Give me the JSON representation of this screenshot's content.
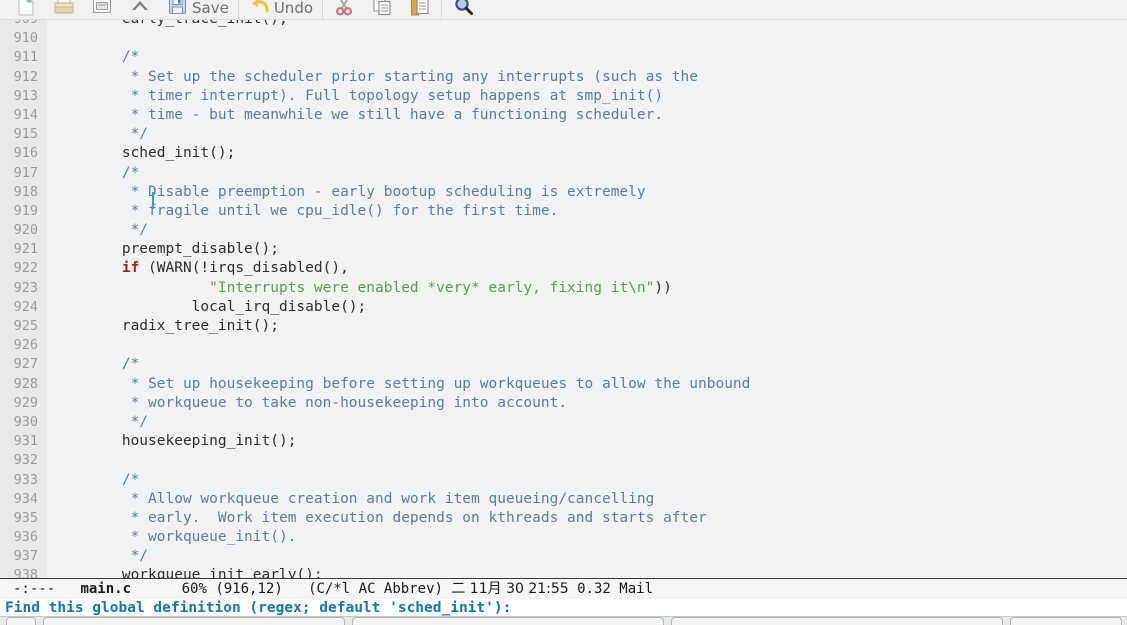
{
  "toolbar": {
    "items": [
      {
        "name": "new-file-icon",
        "icon": "new-file",
        "label": ""
      },
      {
        "name": "open-file-icon",
        "icon": "open-file",
        "label": ""
      },
      {
        "name": "dired-icon",
        "icon": "dired",
        "label": ""
      },
      {
        "name": "close-buffer-icon",
        "icon": "close-buffer",
        "label": ""
      },
      {
        "name": "save-button",
        "icon": "save",
        "label": "Save"
      },
      {
        "name": "undo-button",
        "icon": "undo",
        "label": "Undo"
      },
      {
        "name": "cut-icon",
        "icon": "cut",
        "label": ""
      },
      {
        "name": "copy-icon",
        "icon": "copy",
        "label": ""
      },
      {
        "name": "paste-icon",
        "icon": "paste",
        "label": ""
      },
      {
        "name": "search-icon",
        "icon": "search",
        "label": ""
      }
    ]
  },
  "buffer": {
    "first_line": 909,
    "lines": [
      {
        "num": "909",
        "segments": [
          {
            "text": "        early_trace_init();",
            "style": "plain"
          }
        ]
      },
      {
        "num": "910",
        "segments": [
          {
            "text": "",
            "style": "plain"
          }
        ]
      },
      {
        "num": "911",
        "segments": [
          {
            "text": "        /*",
            "style": "cmt"
          }
        ]
      },
      {
        "num": "912",
        "segments": [
          {
            "text": "         * Set up the scheduler prior starting any interrupts (such as the",
            "style": "cmt"
          }
        ]
      },
      {
        "num": "913",
        "segments": [
          {
            "text": "         * timer interrupt). Full topology setup happens at smp_init()",
            "style": "cmt"
          }
        ]
      },
      {
        "num": "914",
        "segments": [
          {
            "text": "         * time - but meanwhile we still have a functioning scheduler.",
            "style": "cmt"
          }
        ]
      },
      {
        "num": "915",
        "segments": [
          {
            "text": "         */",
            "style": "cmt"
          }
        ]
      },
      {
        "num": "916",
        "segments": [
          {
            "text": "        sched_init();",
            "style": "plain"
          }
        ]
      },
      {
        "num": "917",
        "segments": [
          {
            "text": "        /*",
            "style": "cmt"
          }
        ]
      },
      {
        "num": "918",
        "segments": [
          {
            "text": "         * Disable preemption - early bootup scheduling is extremely",
            "style": "cmt"
          }
        ]
      },
      {
        "num": "919",
        "segments": [
          {
            "text": "         * fragile until we cpu_idle() for the first time.",
            "style": "cmt"
          }
        ]
      },
      {
        "num": "920",
        "segments": [
          {
            "text": "         */",
            "style": "cmt"
          }
        ]
      },
      {
        "num": "921",
        "segments": [
          {
            "text": "        preempt_disable();",
            "style": "plain"
          }
        ]
      },
      {
        "num": "922",
        "segments": [
          {
            "text": "        ",
            "style": "plain"
          },
          {
            "text": "if",
            "style": "kw"
          },
          {
            "text": " (WARN(!irqs_disabled(),",
            "style": "plain"
          }
        ]
      },
      {
        "num": "923",
        "segments": [
          {
            "text": "                  ",
            "style": "plain"
          },
          {
            "text": "\"Interrupts were enabled *very* early, fixing it\\n\"",
            "style": "str"
          },
          {
            "text": "))",
            "style": "plain"
          }
        ]
      },
      {
        "num": "924",
        "segments": [
          {
            "text": "                local_irq_disable();",
            "style": "plain"
          }
        ]
      },
      {
        "num": "925",
        "segments": [
          {
            "text": "        radix_tree_init();",
            "style": "plain"
          }
        ]
      },
      {
        "num": "926",
        "segments": [
          {
            "text": "",
            "style": "plain"
          }
        ]
      },
      {
        "num": "927",
        "segments": [
          {
            "text": "        /*",
            "style": "cmt"
          }
        ]
      },
      {
        "num": "928",
        "segments": [
          {
            "text": "         * Set up housekeeping before setting up workqueues to allow the unbound",
            "style": "cmt"
          }
        ]
      },
      {
        "num": "929",
        "segments": [
          {
            "text": "         * workqueue to take non-housekeeping into account.",
            "style": "cmt"
          }
        ]
      },
      {
        "num": "930",
        "segments": [
          {
            "text": "         */",
            "style": "cmt"
          }
        ]
      },
      {
        "num": "931",
        "segments": [
          {
            "text": "        housekeeping_init();",
            "style": "plain"
          }
        ]
      },
      {
        "num": "932",
        "segments": [
          {
            "text": "",
            "style": "plain"
          }
        ]
      },
      {
        "num": "933",
        "segments": [
          {
            "text": "        /*",
            "style": "cmt"
          }
        ]
      },
      {
        "num": "934",
        "segments": [
          {
            "text": "         * Allow workqueue creation and work item queueing/cancelling",
            "style": "cmt"
          }
        ]
      },
      {
        "num": "935",
        "segments": [
          {
            "text": "         * early.  Work item execution depends on kthreads and starts after",
            "style": "cmt"
          }
        ]
      },
      {
        "num": "936",
        "segments": [
          {
            "text": "         * workqueue_init().",
            "style": "cmt"
          }
        ]
      },
      {
        "num": "937",
        "segments": [
          {
            "text": "         */",
            "style": "cmt"
          }
        ]
      },
      {
        "num": "938",
        "segments": [
          {
            "text": "        workqueue_init_early();",
            "style": "plain"
          }
        ]
      }
    ]
  },
  "modeline": {
    "dashes": "-:---",
    "buffer_name": "main.c",
    "gap1": "      ",
    "position": "60% (916,12)",
    "gap2": "   ",
    "major_mode": "(C/*l AC Abbrev)",
    "gap3": " ",
    "datetime": "二 11月 30 21:55",
    "gap4": " ",
    "load": "0.32",
    "gap5": " ",
    "mail": "Mail"
  },
  "minibuffer": {
    "prompt": "Find this global definition (regex; default 'sched_init'):",
    "input_value": ""
  },
  "colors": {
    "comment": "#5a7ca6",
    "string": "#54a054",
    "keyword": "#a52020",
    "cursor": "#2aa7c8",
    "prompt": "#1178a8",
    "buffer_bg": "#f2f2f2",
    "gutter_bg": "#e9e9e9",
    "linenum": "#9a9a9a"
  }
}
